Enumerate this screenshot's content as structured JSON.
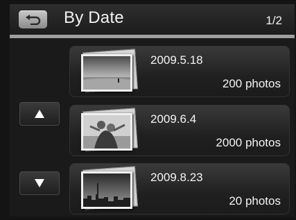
{
  "header": {
    "title": "By Date",
    "page_indicator": "1/2",
    "back_icon": "back-arrow-icon"
  },
  "navigation": {
    "up_icon": "up-triangle-icon",
    "down_icon": "down-triangle-icon"
  },
  "groups": [
    {
      "date": "2009.5.18",
      "count": "200 photos",
      "thumbnail": "beach-landscape"
    },
    {
      "date": "2009.6.4",
      "count": "2000 photos",
      "thumbnail": "two-people-embracing"
    },
    {
      "date": "2009.8.23",
      "count": "20 photos",
      "thumbnail": "city-skyline"
    }
  ],
  "colors": {
    "background": "#141414",
    "divider": "#9e9e9e",
    "text": "#f4f4f4"
  }
}
